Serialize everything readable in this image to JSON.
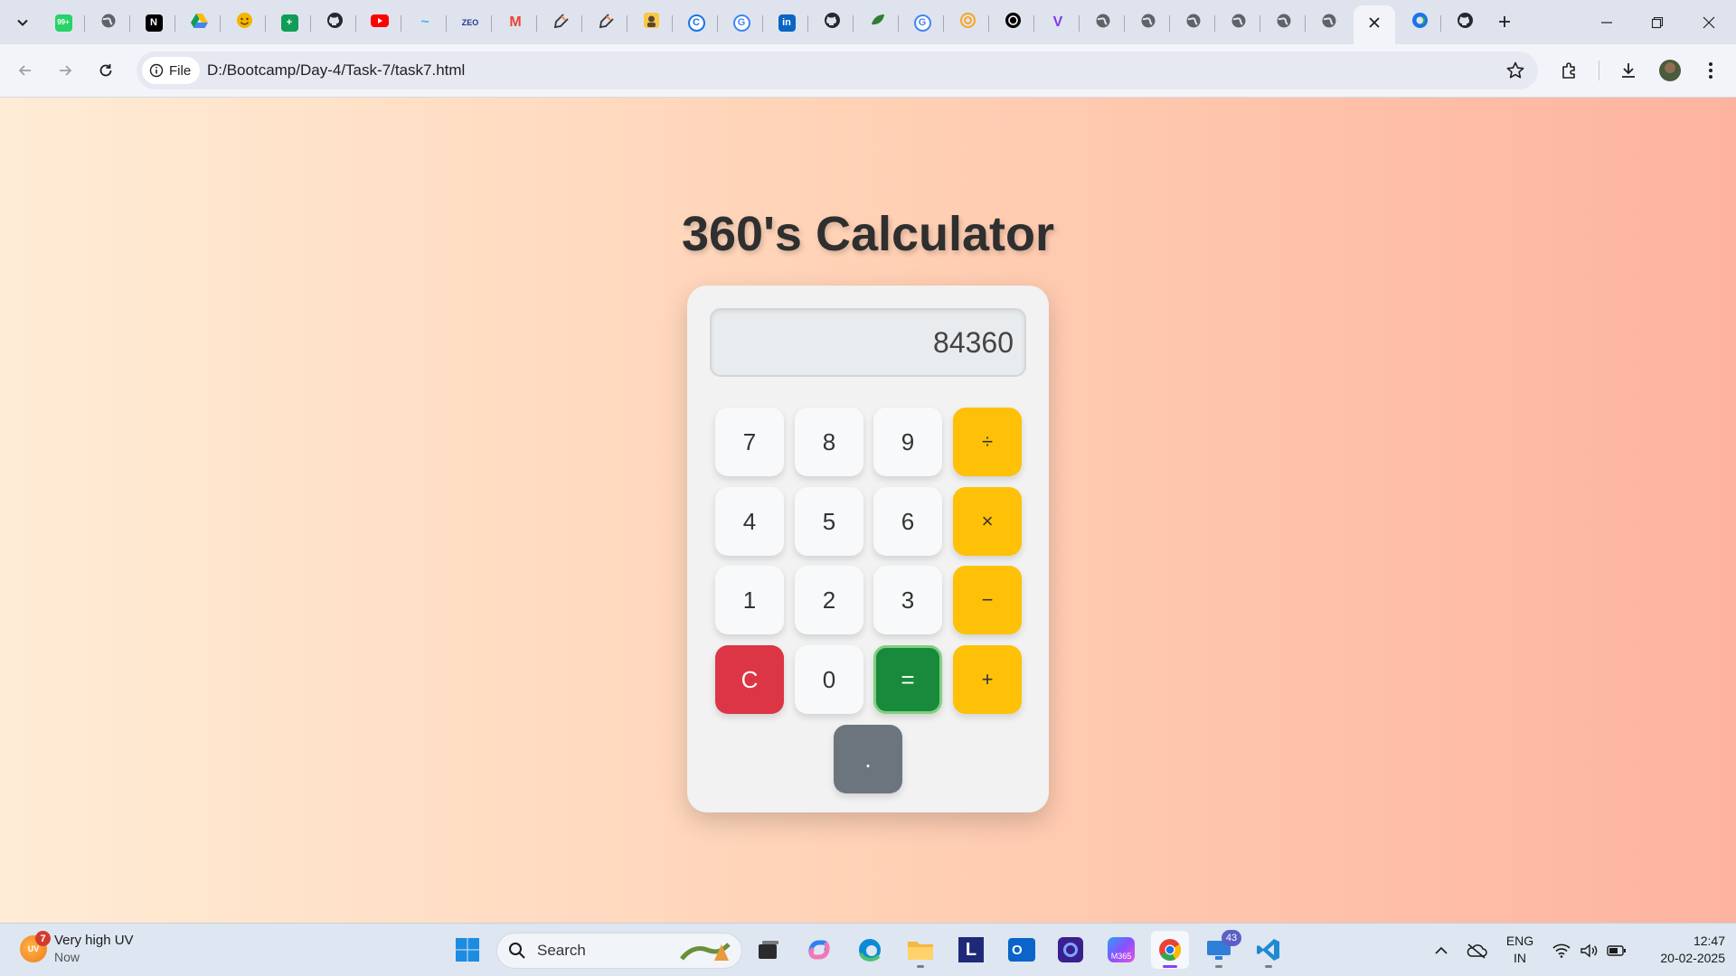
{
  "browser": {
    "tabs": [
      {
        "icon": "whatsapp-icon",
        "color": "#25d366",
        "glyph": "99+"
      },
      {
        "icon": "globe-icon",
        "color": "#5f6368",
        "glyph": ""
      },
      {
        "icon": "notion-icon",
        "color": "#000000",
        "glyph": "N"
      },
      {
        "icon": "google-drive-icon",
        "color": "#fbbc04",
        "glyph": ""
      },
      {
        "icon": "emoji-icon",
        "color": "#f4b400",
        "glyph": ""
      },
      {
        "icon": "google-sheets-icon",
        "color": "#0f9d58",
        "glyph": "+"
      },
      {
        "icon": "github-icon",
        "color": "#24292e",
        "glyph": ""
      },
      {
        "icon": "youtube-icon",
        "color": "#ff0000",
        "glyph": ""
      },
      {
        "icon": "tailwind-icon",
        "color": "#38bdf8",
        "glyph": "~"
      },
      {
        "icon": "zeo-icon",
        "color": "#1f3a93",
        "glyph": "ZEO"
      },
      {
        "icon": "gmail-icon",
        "color": "#ea4335",
        "glyph": "M"
      },
      {
        "icon": "pen-tool-icon",
        "color": "#333333",
        "glyph": ""
      },
      {
        "icon": "pen-tool-icon",
        "color": "#333333",
        "glyph": ""
      },
      {
        "icon": "sticker-icon",
        "color": "#f9c846",
        "glyph": ""
      },
      {
        "icon": "c-letter-icon",
        "color": "#1a73e8",
        "glyph": "C"
      },
      {
        "icon": "google-icon",
        "color": "#4285f4",
        "glyph": "G"
      },
      {
        "icon": "linkedin-icon",
        "color": "#0a66c2",
        "glyph": "in"
      },
      {
        "icon": "github-icon",
        "color": "#24292e",
        "glyph": ""
      },
      {
        "icon": "leaf-icon",
        "color": "#2e7d32",
        "glyph": ""
      },
      {
        "icon": "google-icon",
        "color": "#4285f4",
        "glyph": "G"
      },
      {
        "icon": "swirl-icon",
        "color": "#f5a623",
        "glyph": ""
      },
      {
        "icon": "openai-icon",
        "color": "#000000",
        "glyph": ""
      },
      {
        "icon": "vercel-v-icon",
        "color": "#7c3aed",
        "glyph": "V"
      },
      {
        "icon": "globe-icon",
        "color": "#5f6368",
        "glyph": ""
      },
      {
        "icon": "globe-icon",
        "color": "#5f6368",
        "glyph": ""
      },
      {
        "icon": "globe-icon",
        "color": "#5f6368",
        "glyph": ""
      },
      {
        "icon": "globe-icon",
        "color": "#5f6368",
        "glyph": ""
      },
      {
        "icon": "globe-icon",
        "color": "#5f6368",
        "glyph": ""
      },
      {
        "icon": "globe-icon",
        "color": "#5f6368",
        "glyph": ""
      },
      {
        "icon": "close-icon",
        "color": "#1f1f1f",
        "glyph": "",
        "active": true
      },
      {
        "icon": "copilot-icon",
        "color": "#1a73e8",
        "glyph": ""
      },
      {
        "icon": "github-icon",
        "color": "#24292e",
        "glyph": ""
      }
    ],
    "chip_label": "File",
    "url": "D:/Bootcamp/Day-4/Task-7/task7.html"
  },
  "calculator": {
    "title": "360's Calculator",
    "display_value": "84360",
    "keys": [
      {
        "label": "7",
        "name": "key-7",
        "kind": "num"
      },
      {
        "label": "8",
        "name": "key-8",
        "kind": "num"
      },
      {
        "label": "9",
        "name": "key-9",
        "kind": "num"
      },
      {
        "label": "÷",
        "name": "key-divide",
        "kind": "op"
      },
      {
        "label": "4",
        "name": "key-4",
        "kind": "num"
      },
      {
        "label": "5",
        "name": "key-5",
        "kind": "num"
      },
      {
        "label": "6",
        "name": "key-6",
        "kind": "num"
      },
      {
        "label": "×",
        "name": "key-multiply",
        "kind": "op"
      },
      {
        "label": "1",
        "name": "key-1",
        "kind": "num"
      },
      {
        "label": "2",
        "name": "key-2",
        "kind": "num"
      },
      {
        "label": "3",
        "name": "key-3",
        "kind": "num"
      },
      {
        "label": "−",
        "name": "key-subtract",
        "kind": "op"
      },
      {
        "label": "C",
        "name": "key-clear",
        "kind": "clear"
      },
      {
        "label": "0",
        "name": "key-0",
        "kind": "num"
      },
      {
        "label": "=",
        "name": "key-equals",
        "kind": "equals"
      },
      {
        "label": "+",
        "name": "key-add",
        "kind": "op"
      },
      {
        "label": ".",
        "name": "key-decimal",
        "kind": "dot"
      }
    ],
    "colors": {
      "operator": "#ffc107",
      "clear": "#dc3545",
      "equals": "#198a3c",
      "decimal": "#6c757d"
    }
  },
  "taskbar": {
    "weather_title": "Very high UV",
    "weather_sub": "Now",
    "weather_badge": "7",
    "weather_icon_text": "UV",
    "search_label": "Search",
    "outlook_badge": "43",
    "lang_line1": "ENG",
    "lang_line2": "IN",
    "time": "12:47",
    "date": "20-02-2025"
  }
}
